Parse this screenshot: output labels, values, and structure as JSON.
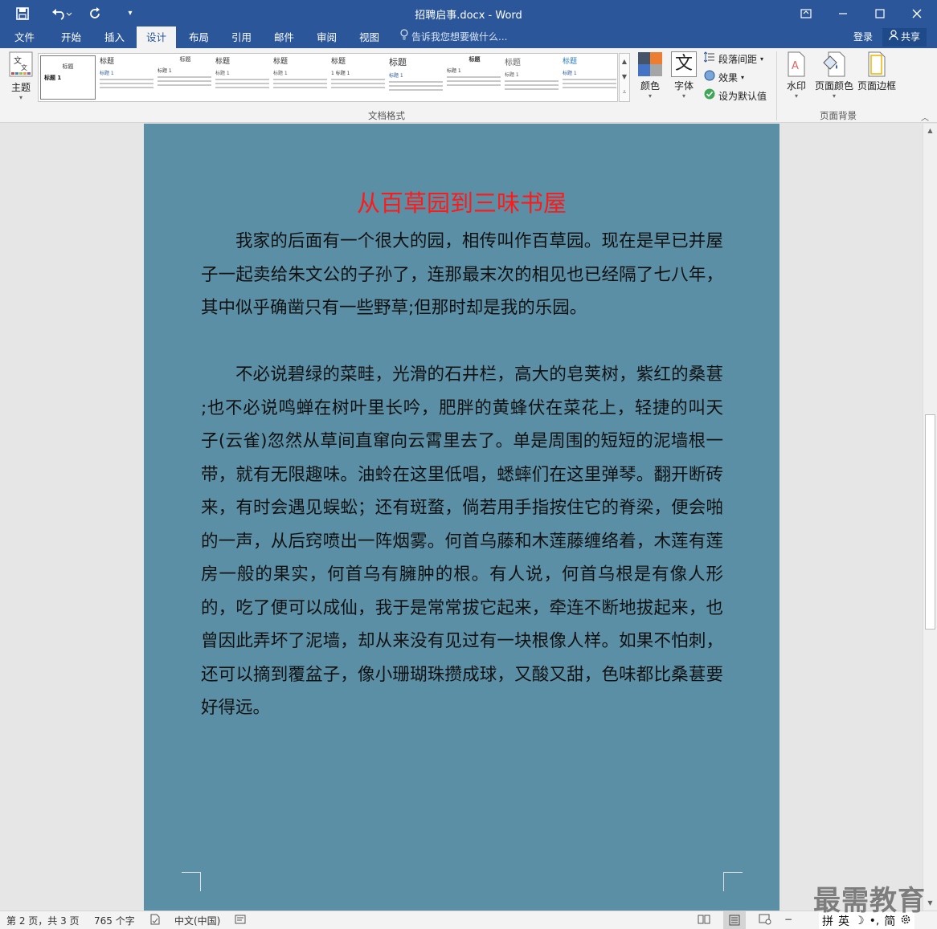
{
  "titlebar": {
    "title": "招聘启事.docx - Word",
    "save_icon": "save-icon",
    "undo_icon": "undo-icon",
    "redo_icon": "repeat-icon"
  },
  "tabs": {
    "items": [
      "文件",
      "开始",
      "插入",
      "设计",
      "布局",
      "引用",
      "邮件",
      "审阅",
      "视图"
    ],
    "active": "设计",
    "tell_me": "告诉我您想要做什么...",
    "login": "登录",
    "share": "共享"
  },
  "ribbon": {
    "theme_label": "主题",
    "gallery": [
      {
        "title": "标题",
        "heading": "标题 1"
      },
      {
        "title": "标题",
        "heading": "标题 1"
      },
      {
        "title": "标题",
        "heading": "标题 1"
      },
      {
        "title": "标题",
        "heading": "标题 1"
      },
      {
        "title": "标题",
        "heading": "标题 1"
      },
      {
        "title": "标题",
        "heading": "1  标题 1"
      },
      {
        "title": "标题",
        "heading": "标题 1"
      },
      {
        "title": "标题",
        "heading": "标题 1"
      },
      {
        "title": "标题",
        "heading": "标题 1"
      },
      {
        "title": "标题",
        "heading": "标题 1"
      }
    ],
    "colors_label": "颜色",
    "fonts_label": "字体",
    "font_glyph": "文",
    "paragraph_spacing": "段落间距",
    "effects": "效果",
    "set_default": "设为默认值",
    "doc_format_group": "文档格式",
    "watermark_label": "水印",
    "page_color_label": "页面颜色",
    "page_border_label": "页面边框",
    "page_background_group": "页面背景"
  },
  "document": {
    "heading": "从百草园到三味书屋",
    "paragraphs": [
      "我家的后面有一个很大的园，相传叫作百草园。现在是早已并屋子一起卖给朱文公的子孙了，连那最末次的相见也已经隔了七八年，其中似乎确凿只有一些野草;但那时却是我的乐园。",
      "不必说碧绿的菜畦，光滑的石井栏，高大的皂荚树，紫红的桑葚  ;也不必说鸣蝉在树叶里长吟，肥胖的黄蜂伏在菜花上，轻捷的叫天子(云雀)忽然从草间直窜向云霄里去了。单是周围的短短的泥墙根一带，就有无限趣味。油蛉在这里低唱，蟋蟀们在这里弹琴。翻开断砖来，有时会遇见蜈蚣；还有斑蝥，倘若用手指按住它的脊梁，便会啪的一声，从后窍喷出一阵烟雾。何首乌藤和木莲藤缠络着，木莲有莲房一般的果实，何首乌有臃肿的根。有人说，何首乌根是有像人形的，吃了便可以成仙，我于是常常拔它起来，牵连不断地拔起来，也曾因此弄坏了泥墙，却从来没有见过有一块根像人样。如果不怕刺，还可以摘到覆盆子，像小珊瑚珠攒成球，又酸又甜，色味都比桑葚要好得远。"
    ],
    "page_color": "#5b8fa6",
    "heading_color": "#ff1a1a"
  },
  "statusbar": {
    "page": "第 2 页，共 3 页",
    "words": "765 个字",
    "language": "中文(中国)"
  },
  "ime": {
    "layout": "拼",
    "mode": "英",
    "moon": "☽",
    "punct": "•,",
    "simplified": "简",
    "settings_icon": "gear-icon"
  },
  "watermark_text": "最需教育"
}
